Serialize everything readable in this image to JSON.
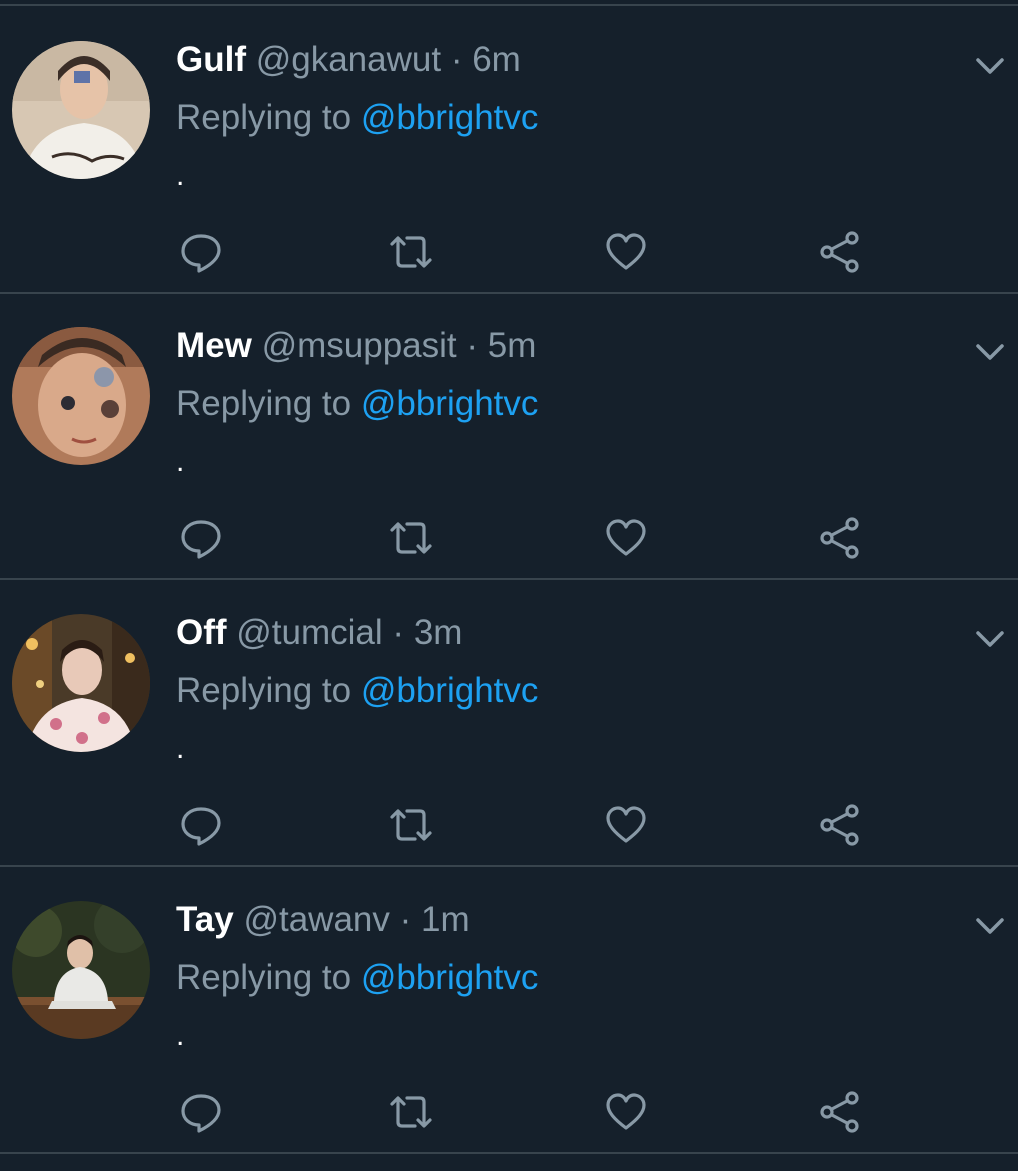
{
  "reply_prefix": "Replying to",
  "tweets": [
    {
      "name": "Gulf",
      "handle": "@gkanawut",
      "separator": "·",
      "time": "6m",
      "replying_to": "@bbrightvc",
      "text": ".",
      "avatar_colors": [
        "#d7c7b3",
        "#f2efe9",
        "#3b2e27"
      ]
    },
    {
      "name": "Mew",
      "handle": "@msuppasit",
      "separator": "·",
      "time": "5m",
      "replying_to": "@bbrightvc",
      "text": ".",
      "avatar_colors": [
        "#b07a5a",
        "#d9a98a",
        "#3a2a22"
      ]
    },
    {
      "name": "Off",
      "handle": "@tumcial",
      "separator": "·",
      "time": "3m",
      "replying_to": "@bbrightvc",
      "text": ".",
      "avatar_colors": [
        "#4a3a28",
        "#e8c9b8",
        "#d1708a"
      ]
    },
    {
      "name": "Tay",
      "handle": "@tawanv",
      "separator": "·",
      "time": "1m",
      "replying_to": "@bbrightvc",
      "text": ".",
      "avatar_colors": [
        "#2b3522",
        "#e9e9e6",
        "#5a3a22"
      ]
    }
  ],
  "icons": {
    "reply": "comment-icon",
    "retweet": "retweet-icon",
    "like": "heart-icon",
    "share": "share-icon",
    "menu": "chevron-down-icon"
  },
  "colors": {
    "background": "#15202b",
    "divider": "#38444d",
    "secondary_text": "#8899a6",
    "link": "#1da1f2",
    "primary_text": "#ffffff"
  }
}
